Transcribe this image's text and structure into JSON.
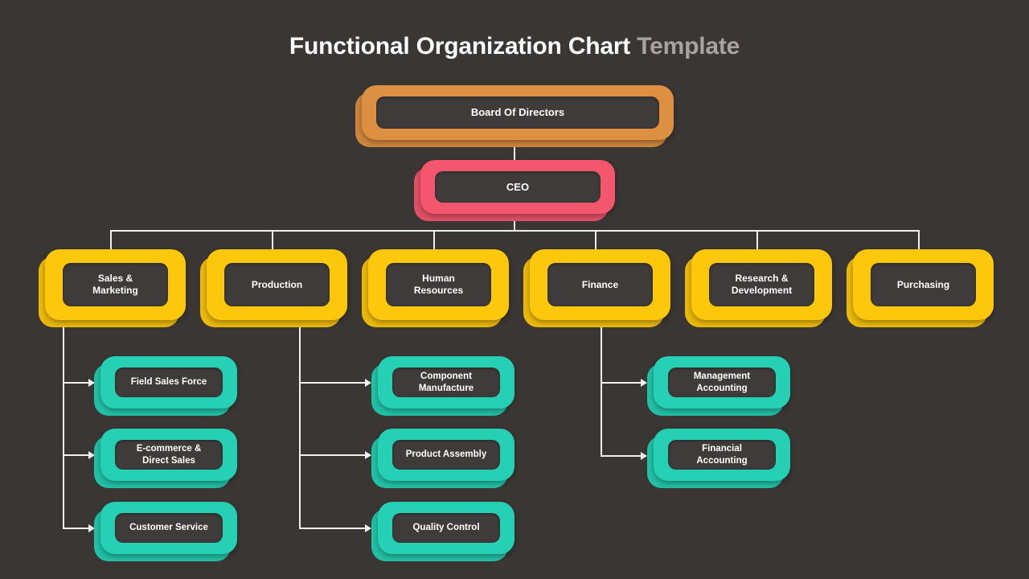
{
  "title": {
    "main": "Functional Organization Chart ",
    "accent": "Template"
  },
  "colors": {
    "background": "#3a3634",
    "board": "#dd9042",
    "ceo": "#f4566e",
    "department": "#fdc70c",
    "sub": "#25d0b4",
    "inner_panel": "#3f3b3a",
    "connector": "#f2f0ee",
    "title_main": "#ffffff",
    "title_accent": "#a9a3a0"
  },
  "nodes": {
    "board": "Board Of Directors",
    "ceo": "CEO",
    "departments": [
      {
        "label": "Sales &\nMarketing"
      },
      {
        "label": "Production"
      },
      {
        "label": "Human\nResources"
      },
      {
        "label": "Finance"
      },
      {
        "label": "Research &\nDevelopment"
      },
      {
        "label": "Purchasing"
      }
    ],
    "sub_sales": [
      {
        "label": "Field Sales Force"
      },
      {
        "label": "E-commerce &\nDirect Sales"
      },
      {
        "label": "Customer Service"
      }
    ],
    "sub_production": [
      {
        "label": "Component\nManufacture"
      },
      {
        "label": "Product Assembly"
      },
      {
        "label": "Quality Control"
      }
    ],
    "sub_finance": [
      {
        "label": "Management\nAccounting"
      },
      {
        "label": "Financial\nAccounting"
      }
    ]
  },
  "chart_data": {
    "type": "diagram",
    "diagram_type": "organization-chart",
    "title": "Functional Organization Chart Template",
    "levels": [
      {
        "level": 1,
        "color": "#dd9042",
        "nodes": [
          "Board Of Directors"
        ]
      },
      {
        "level": 2,
        "color": "#f4566e",
        "nodes": [
          "CEO"
        ]
      },
      {
        "level": 3,
        "color": "#fdc70c",
        "nodes": [
          "Sales & Marketing",
          "Production",
          "Human Resources",
          "Finance",
          "Research & Development",
          "Purchasing"
        ]
      },
      {
        "level": 4,
        "color": "#25d0b4",
        "nodes": [
          "Field Sales Force",
          "E-commerce & Direct Sales",
          "Customer Service",
          "Component Manufacture",
          "Product Assembly",
          "Quality Control",
          "Management Accounting",
          "Financial Accounting"
        ]
      }
    ],
    "edges": [
      {
        "from": "Board Of Directors",
        "to": "CEO"
      },
      {
        "from": "CEO",
        "to": "Sales & Marketing"
      },
      {
        "from": "CEO",
        "to": "Production"
      },
      {
        "from": "CEO",
        "to": "Human Resources"
      },
      {
        "from": "CEO",
        "to": "Finance"
      },
      {
        "from": "CEO",
        "to": "Research & Development"
      },
      {
        "from": "CEO",
        "to": "Purchasing"
      },
      {
        "from": "Sales & Marketing",
        "to": "Field Sales Force"
      },
      {
        "from": "Sales & Marketing",
        "to": "E-commerce & Direct Sales"
      },
      {
        "from": "Sales & Marketing",
        "to": "Customer Service"
      },
      {
        "from": "Production",
        "to": "Component Manufacture"
      },
      {
        "from": "Production",
        "to": "Product Assembly"
      },
      {
        "from": "Production",
        "to": "Quality Control"
      },
      {
        "from": "Finance",
        "to": "Management Accounting"
      },
      {
        "from": "Finance",
        "to": "Financial Accounting"
      }
    ]
  }
}
